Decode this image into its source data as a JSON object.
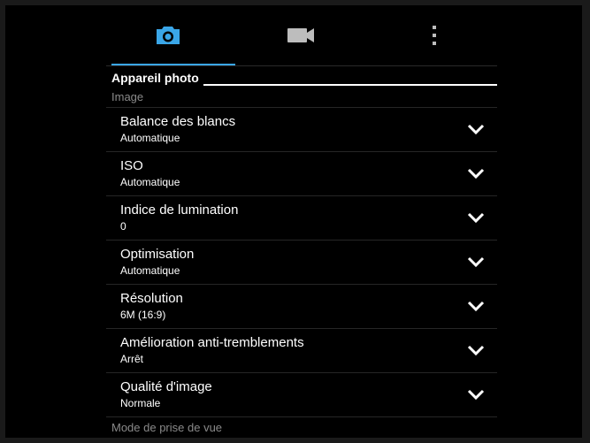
{
  "tabs": [
    {
      "icon": "camera-icon",
      "active": true
    },
    {
      "icon": "video-icon",
      "active": false
    },
    {
      "icon": "more-vertical-icon",
      "active": false
    }
  ],
  "colors": {
    "accent": "#3aa6e8",
    "background": "#000000",
    "muted_text": "#8a8a8a"
  },
  "section_title": "Appareil photo",
  "category_image": "Image",
  "settings": [
    {
      "title": "Balance des blancs",
      "value": "Automatique"
    },
    {
      "title": "ISO",
      "value": "Automatique"
    },
    {
      "title": "Indice de lumination",
      "value": "0"
    },
    {
      "title": "Optimisation",
      "value": "Automatique"
    },
    {
      "title": "Résolution",
      "value": "6M (16:9)"
    },
    {
      "title": "Amélioration anti-tremblements",
      "value": "Arrêt"
    },
    {
      "title": "Qualité d'image",
      "value": "Normale"
    }
  ],
  "category_mode": "Mode de prise de vue"
}
